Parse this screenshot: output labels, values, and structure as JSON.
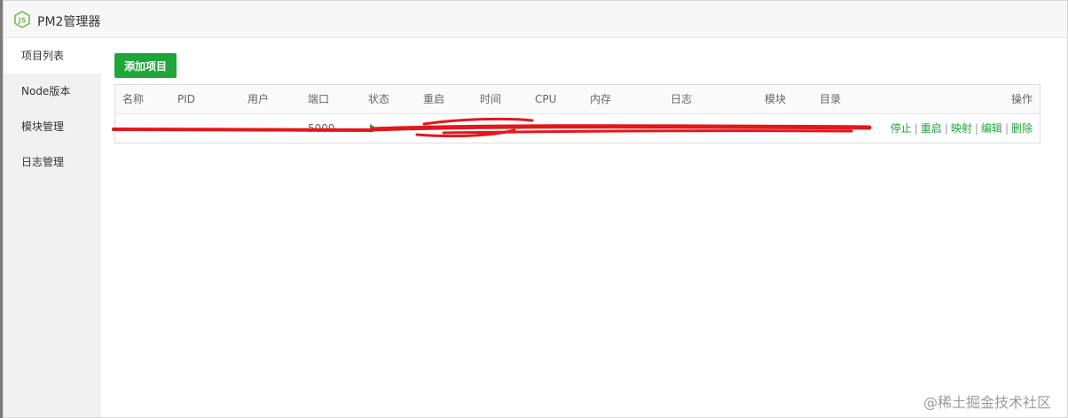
{
  "window": {
    "title": "PM2管理器",
    "icon": "nodejs-icon"
  },
  "sidebar": {
    "items": [
      {
        "label": "项目列表",
        "active": true
      },
      {
        "label": "Node版本",
        "active": false
      },
      {
        "label": "模块管理",
        "active": false
      },
      {
        "label": "日志管理",
        "active": false
      }
    ]
  },
  "toolbar": {
    "add_label": "添加项目"
  },
  "table": {
    "columns": [
      "名称",
      "PID",
      "用户",
      "端口",
      "状态",
      "重启",
      "时间",
      "CPU",
      "内存",
      "日志",
      "模块",
      "目录",
      "操作"
    ],
    "rows": [
      {
        "port": "5000",
        "status_icon": "play-icon",
        "actions": [
          "停止",
          "重启",
          "映射",
          "编辑",
          "删除"
        ]
      }
    ]
  },
  "watermark": "@稀土掘金技术社区",
  "colors": {
    "accent": "#20a53a",
    "redaction": "#e3171c",
    "sidebar_bg": "#f1f1f1"
  }
}
